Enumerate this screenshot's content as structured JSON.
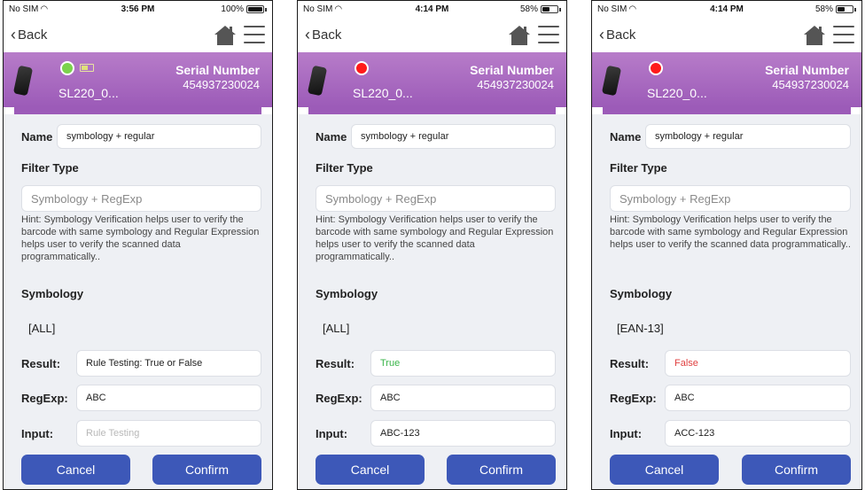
{
  "colors": {
    "header_purple": "#9c5bb8",
    "button_blue": "#3d58b8",
    "status_green": "#7bd24d",
    "status_red": "#ff1a1a",
    "true_green": "#3ab54a",
    "false_red": "#e04040"
  },
  "screens": [
    {
      "status": {
        "carrier": "No SIM",
        "time": "3:56 PM",
        "battery": "100%",
        "battery_level": 1.0
      },
      "nav": {
        "back_label": "Back"
      },
      "header": {
        "device_name": "SL220_0...",
        "serial_label": "Serial Number",
        "serial_value": "454937230024",
        "connection_color": "#7bd24d",
        "show_battery_icon": true
      },
      "form": {
        "name_label": "Name",
        "name_value": "symbology + regular",
        "filter_type_label": "Filter Type",
        "filter_type_value": "Symbology + RegExp",
        "hint": "Hint: Symbology Verification helps user to verify the barcode with same symbology and Regular Expression helps user to  verify the scanned data programmatically..",
        "symbology_label": "Symbology",
        "symbology_value": "[ALL]",
        "result_label": "Result:",
        "result_value": "Rule Testing: True or False",
        "regexp_label": "RegExp:",
        "regexp_value": "ABC",
        "input_label": "Input:",
        "input_placeholder": "Rule Testing",
        "input_value": ""
      },
      "buttons": {
        "cancel": "Cancel",
        "confirm": "Confirm"
      }
    },
    {
      "status": {
        "carrier": "No SIM",
        "time": "4:14 PM",
        "battery": "58%",
        "battery_level": 0.58
      },
      "nav": {
        "back_label": "Back"
      },
      "header": {
        "device_name": "SL220_0...",
        "serial_label": "Serial Number",
        "serial_value": "454937230024",
        "connection_color": "#ff1a1a",
        "show_battery_icon": false
      },
      "form": {
        "name_label": "Name",
        "name_value": "symbology + regular",
        "filter_type_label": "Filter Type",
        "filter_type_value": "Symbology + RegExp",
        "hint": "Hint: Symbology Verification helps user to verify the barcode with same symbology and Regular Expression helps user to  verify the scanned data programmatically..",
        "symbology_label": "Symbology",
        "symbology_value": "[ALL]",
        "result_label": "Result:",
        "result_value": "True",
        "regexp_label": "RegExp:",
        "regexp_value": "ABC",
        "input_label": "Input:",
        "input_placeholder": "",
        "input_value": "ABC-123"
      },
      "buttons": {
        "cancel": "Cancel",
        "confirm": "Confirm"
      }
    },
    {
      "status": {
        "carrier": "No SIM",
        "time": "4:14 PM",
        "battery": "58%",
        "battery_level": 0.58
      },
      "nav": {
        "back_label": "Back"
      },
      "header": {
        "device_name": "SL220_0...",
        "serial_label": "Serial Number",
        "serial_value": "454937230024",
        "connection_color": "#ff1a1a",
        "show_battery_icon": false
      },
      "form": {
        "name_label": "Name",
        "name_value": "symbology + regular",
        "filter_type_label": "Filter Type",
        "filter_type_value": "Symbology + RegExp",
        "hint": "Hint: Symbology Verification helps user to verify the barcode with same symbology and Regular Expression helps user to  verify the scanned data programmatically..",
        "symbology_label": "Symbology",
        "symbology_value": "[EAN-13]",
        "result_label": "Result:",
        "result_value": "False",
        "regexp_label": "RegExp:",
        "regexp_value": "ABC",
        "input_label": "Input:",
        "input_placeholder": "",
        "input_value": "ACC-123"
      },
      "buttons": {
        "cancel": "Cancel",
        "confirm": "Confirm"
      }
    }
  ]
}
